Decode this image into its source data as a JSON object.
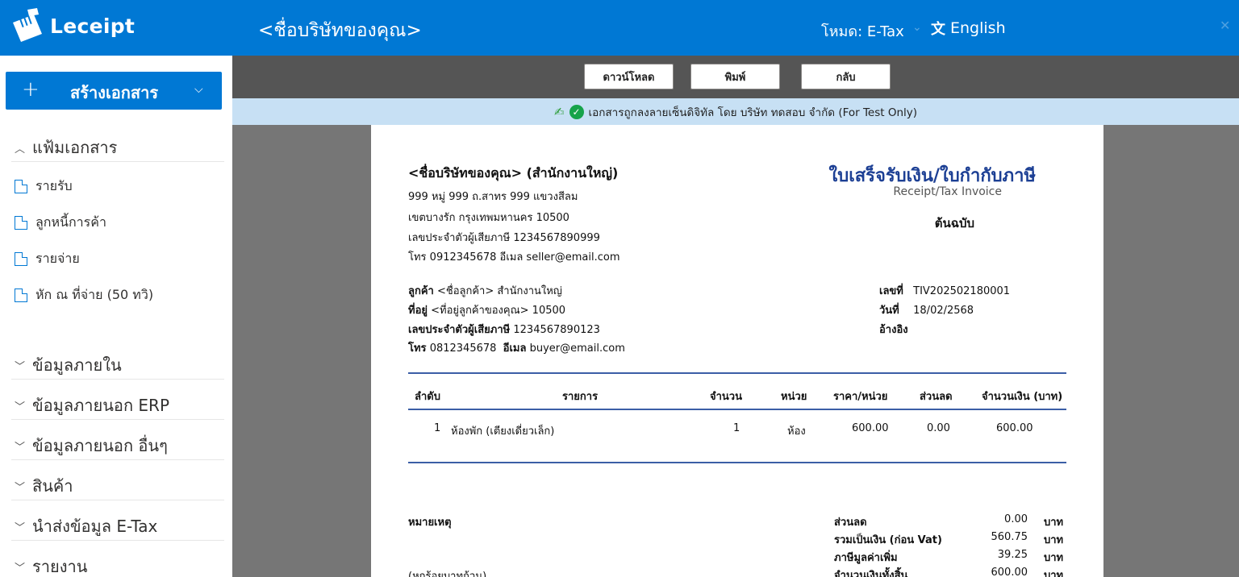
{
  "header": {
    "brand": "Leceipt",
    "company_title": "<ชื่อบริษัทของคุณ>",
    "mode": "โหมด: E-Tax",
    "language": "English"
  },
  "sidebar": {
    "create_button": "สร้างเอกสาร",
    "groups": [
      {
        "label": "แฟ้มเอกสาร",
        "expanded": true
      },
      {
        "label": "ข้อมูลภายใน",
        "expanded": false
      },
      {
        "label": "ข้อมูลภายนอก ERP",
        "expanded": false
      },
      {
        "label": "ข้อมูลภายนอก อื่นๆ",
        "expanded": false
      },
      {
        "label": "สินค้า",
        "expanded": false
      },
      {
        "label": "นำส่งข้อมูล E-Tax",
        "expanded": false
      },
      {
        "label": "รายงาน",
        "expanded": false
      }
    ],
    "folder_items": [
      "รายรับ",
      "ลูกหนี้การค้า",
      "รายจ่าย",
      "หัก ณ ที่จ่าย (50 ทวิ)"
    ]
  },
  "toolbar": {
    "download_label": "ดาวน์โหลด",
    "print_label": "พิมพ์",
    "back_label": "กลับ"
  },
  "signature_notice": "เอกสารถูกลงลายเซ็นดิจิทัล โดย บริษัท ทดสอบ จำกัด (For Test Only)",
  "document": {
    "seller": {
      "name": "<ชื่อบริษัทของคุณ> (สำนักงานใหญ่)",
      "address1": "999 หมู่ 999 ถ.สาทร 999 แขวงสีลม",
      "address2": "เขตบางรัก กรุงเทพมหานคร 10500",
      "tax_id": "เลขประจำตัวผู้เสียภาษี 1234567890999",
      "contact": "โทร 0912345678  อีเมล seller@email.com"
    },
    "title": "ใบเสร็จรับเงิน/ใบกำกับภาษี",
    "subtitle": "Receipt/Tax Invoice",
    "copy_type": "ต้นฉบับ",
    "buyer": {
      "customer_label": "ลูกค้า",
      "customer_value": "<ชื่อลูกค้า> สำนักงานใหญ่",
      "address_label": "ที่อยู่",
      "address_value": "<ที่อยู่ลูกค้าของคุณ> 10500",
      "tax_label": "เลขประจำตัวผู้เสียภาษี",
      "tax_value": "1234567890123",
      "phone_label": "โทร",
      "phone_value": "0812345678",
      "email_label": "อีเมล",
      "email_value": "buyer@email.com"
    },
    "meta": {
      "number_label": "เลขที่",
      "number_value": "TIV202502180001",
      "date_label": "วันที่",
      "date_value": "18/02/2568",
      "ref_label": "อ้างอิง",
      "ref_value": ""
    },
    "table": {
      "headers": [
        "ลำดับ",
        "รายการ",
        "จำนวน",
        "หน่วย",
        "ราคา/หน่วย",
        "ส่วนลด",
        "จำนวนเงิน (บาท)"
      ],
      "rows": [
        [
          "1",
          "ห้องพัก (เตียงเดี่ยวเล็ก)",
          "1",
          "ห้อง",
          "600.00",
          "0.00",
          "600.00"
        ]
      ]
    },
    "remarks_label": "หมายเหตุ",
    "amount_in_words": "(หกร้อยบาทถ้วน)",
    "summary": [
      {
        "label": "ส่วนลด",
        "value": "0.00",
        "unit": "บาท"
      },
      {
        "label": "รวมเป็นเงิน (ก่อน Vat)",
        "value": "560.75",
        "unit": "บาท"
      },
      {
        "label": "ภาษีมูลค่าเพิ่ม",
        "value": "39.25",
        "unit": "บาท"
      },
      {
        "label": "จำนวนเงินทั้งสิ้น",
        "value": "600.00",
        "unit": "บาท"
      }
    ]
  },
  "colors": {
    "brand_blue": "#0078d4",
    "sign_bar": "#c7e0f4",
    "title_blue": "#1c3f94"
  }
}
